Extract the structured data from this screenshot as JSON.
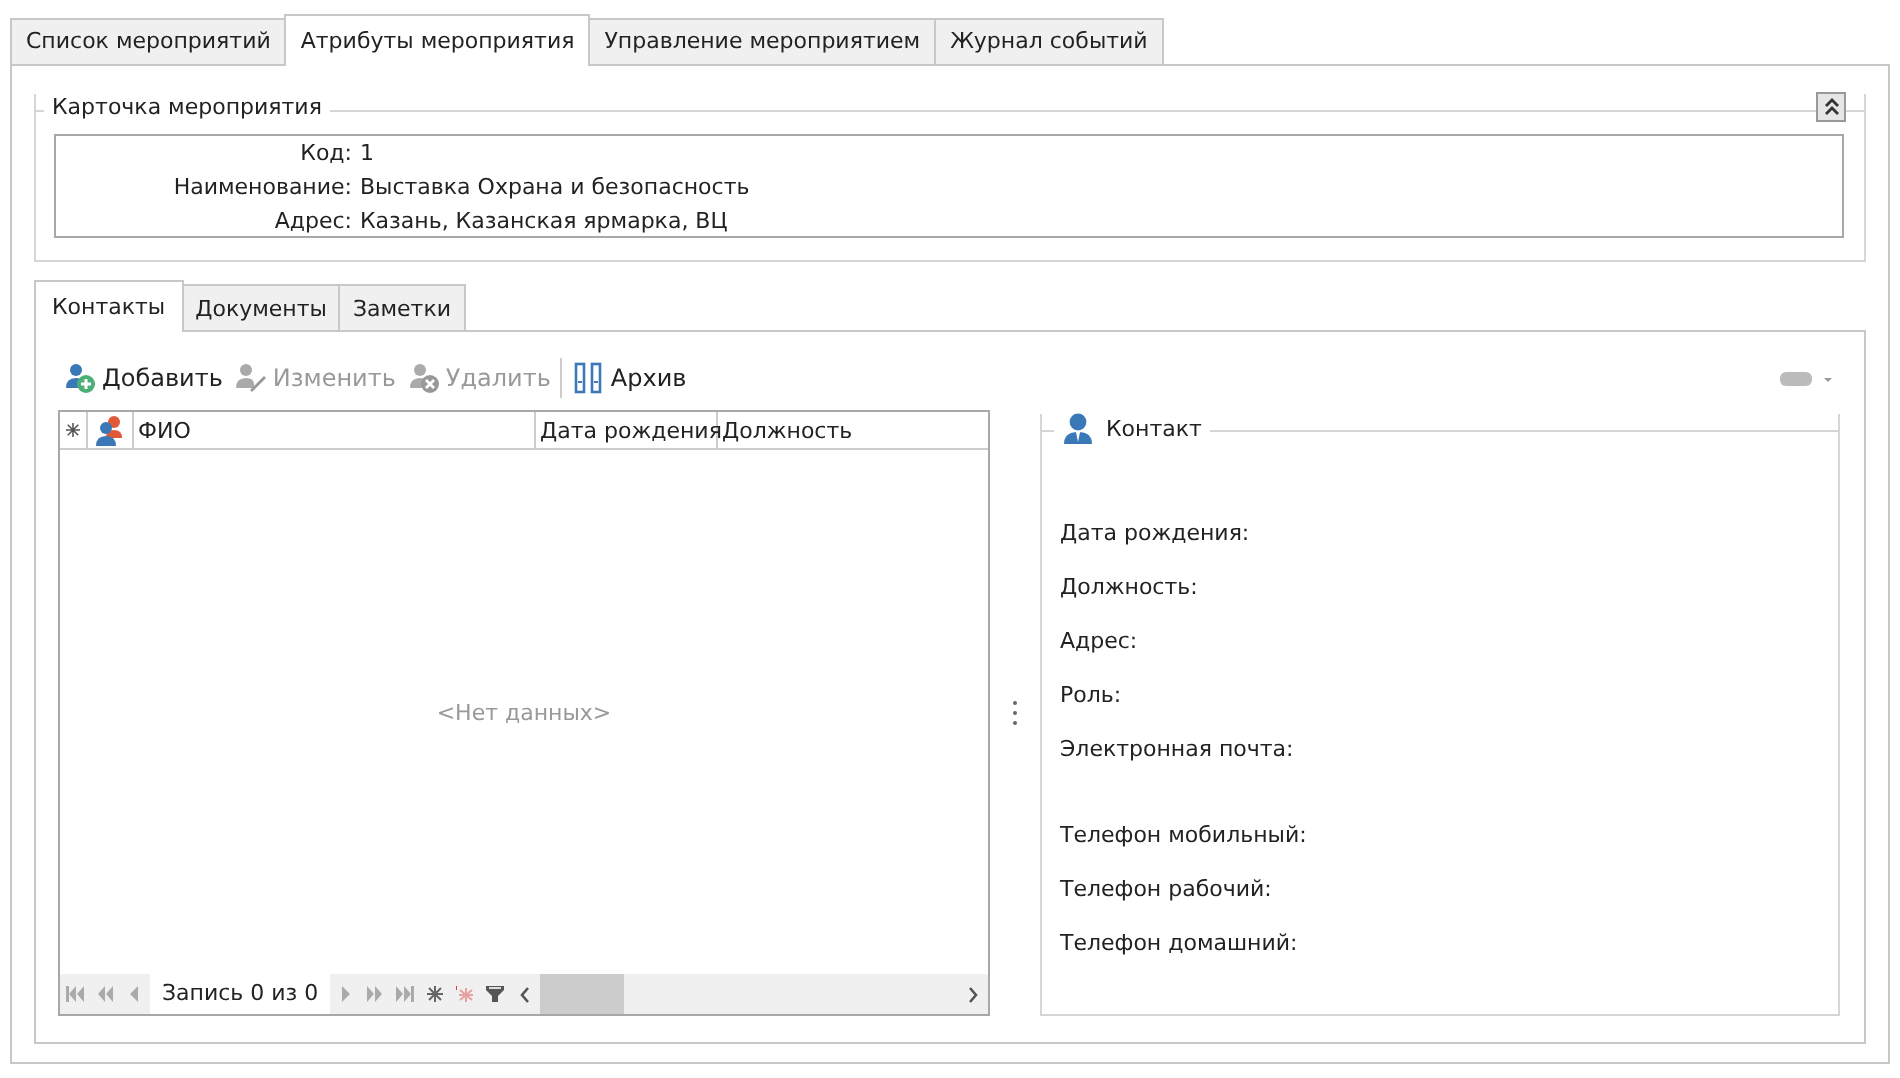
{
  "tabs": [
    {
      "label": "Список мероприятий",
      "selected": false
    },
    {
      "label": "Атрибуты мероприятия",
      "selected": true
    },
    {
      "label": "Управление мероприятием",
      "selected": false
    },
    {
      "label": "Журнал событий",
      "selected": false
    }
  ],
  "card": {
    "title": "Карточка мероприятия",
    "expanded": true,
    "fields": [
      {
        "label": "Код:",
        "value": "1"
      },
      {
        "label": "Наименование:",
        "value": "Выставка Охрана и безопасность"
      },
      {
        "label": "Адрес:",
        "value": "Казань,  Казанская ярмарка, ВЦ"
      }
    ]
  },
  "inner_tabs": [
    {
      "label": "Контакты",
      "selected": true
    },
    {
      "label": "Документы",
      "selected": false
    },
    {
      "label": "Заметки",
      "selected": false
    }
  ],
  "toolbar": [
    {
      "label": "Добавить",
      "kind": "add",
      "disabled": false
    },
    {
      "label": "Изменить",
      "kind": "edit",
      "disabled": true
    },
    {
      "label": "Удалить",
      "kind": "delete",
      "disabled": true
    },
    {
      "label": "Архив",
      "kind": "archive",
      "disabled": false
    }
  ],
  "grid": {
    "columns": [
      "ФИО",
      "Дата рождения",
      "Должность"
    ],
    "empty_text": "<Нет данных>",
    "record_text": "Запись 0 из 0"
  },
  "contact": {
    "title": "Контакт",
    "field_groups": [
      [
        "Дата рождения:",
        "Должность:",
        "Адрес:",
        "Роль:",
        "Электронная почта:"
      ],
      [
        "Телефон мобильный:",
        "Телефон рабочий:",
        "Телефон домашний:"
      ]
    ]
  }
}
